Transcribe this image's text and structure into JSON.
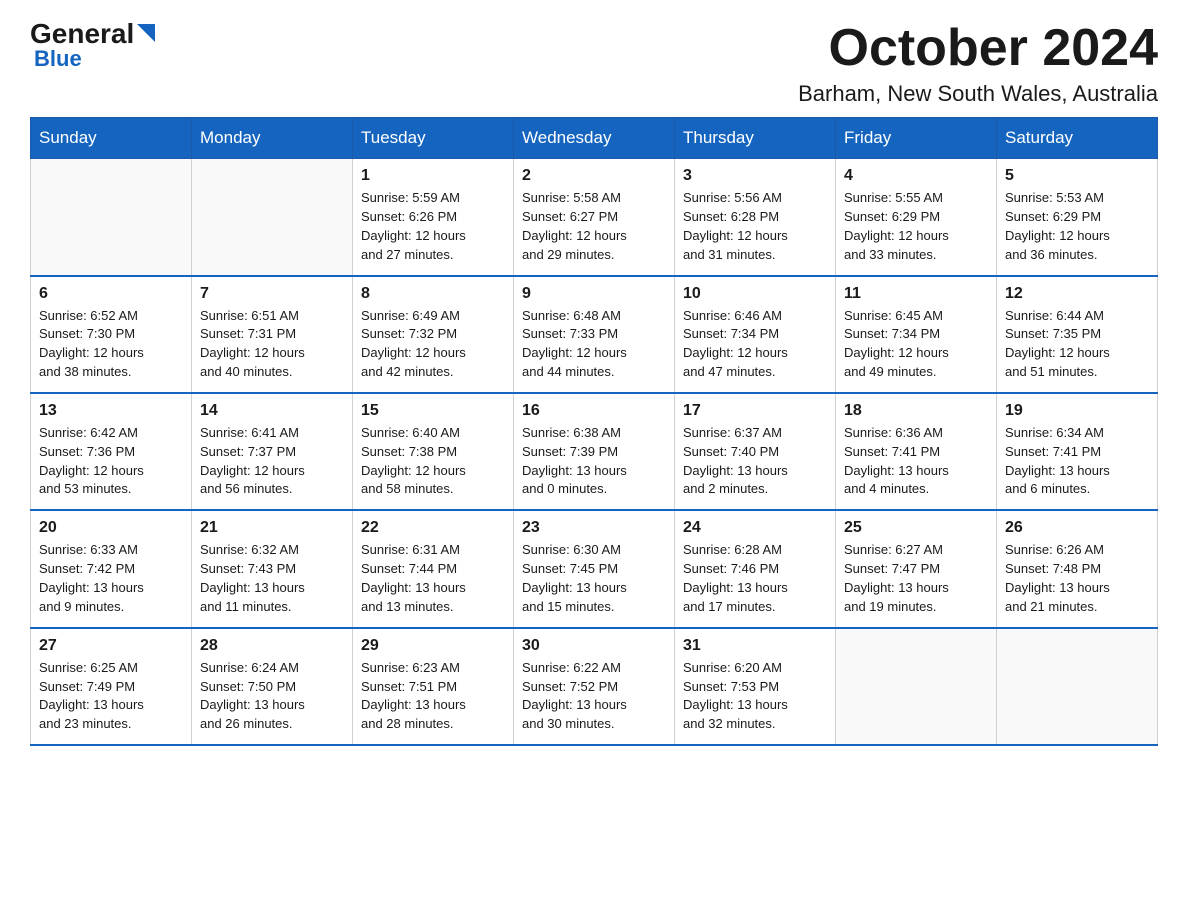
{
  "header": {
    "logo_general": "General",
    "logo_blue": "Blue",
    "month_title": "October 2024",
    "location": "Barham, New South Wales, Australia"
  },
  "weekdays": [
    "Sunday",
    "Monday",
    "Tuesday",
    "Wednesday",
    "Thursday",
    "Friday",
    "Saturday"
  ],
  "weeks": [
    [
      {
        "day": "",
        "info": ""
      },
      {
        "day": "",
        "info": ""
      },
      {
        "day": "1",
        "info": "Sunrise: 5:59 AM\nSunset: 6:26 PM\nDaylight: 12 hours\nand 27 minutes."
      },
      {
        "day": "2",
        "info": "Sunrise: 5:58 AM\nSunset: 6:27 PM\nDaylight: 12 hours\nand 29 minutes."
      },
      {
        "day": "3",
        "info": "Sunrise: 5:56 AM\nSunset: 6:28 PM\nDaylight: 12 hours\nand 31 minutes."
      },
      {
        "day": "4",
        "info": "Sunrise: 5:55 AM\nSunset: 6:29 PM\nDaylight: 12 hours\nand 33 minutes."
      },
      {
        "day": "5",
        "info": "Sunrise: 5:53 AM\nSunset: 6:29 PM\nDaylight: 12 hours\nand 36 minutes."
      }
    ],
    [
      {
        "day": "6",
        "info": "Sunrise: 6:52 AM\nSunset: 7:30 PM\nDaylight: 12 hours\nand 38 minutes."
      },
      {
        "day": "7",
        "info": "Sunrise: 6:51 AM\nSunset: 7:31 PM\nDaylight: 12 hours\nand 40 minutes."
      },
      {
        "day": "8",
        "info": "Sunrise: 6:49 AM\nSunset: 7:32 PM\nDaylight: 12 hours\nand 42 minutes."
      },
      {
        "day": "9",
        "info": "Sunrise: 6:48 AM\nSunset: 7:33 PM\nDaylight: 12 hours\nand 44 minutes."
      },
      {
        "day": "10",
        "info": "Sunrise: 6:46 AM\nSunset: 7:34 PM\nDaylight: 12 hours\nand 47 minutes."
      },
      {
        "day": "11",
        "info": "Sunrise: 6:45 AM\nSunset: 7:34 PM\nDaylight: 12 hours\nand 49 minutes."
      },
      {
        "day": "12",
        "info": "Sunrise: 6:44 AM\nSunset: 7:35 PM\nDaylight: 12 hours\nand 51 minutes."
      }
    ],
    [
      {
        "day": "13",
        "info": "Sunrise: 6:42 AM\nSunset: 7:36 PM\nDaylight: 12 hours\nand 53 minutes."
      },
      {
        "day": "14",
        "info": "Sunrise: 6:41 AM\nSunset: 7:37 PM\nDaylight: 12 hours\nand 56 minutes."
      },
      {
        "day": "15",
        "info": "Sunrise: 6:40 AM\nSunset: 7:38 PM\nDaylight: 12 hours\nand 58 minutes."
      },
      {
        "day": "16",
        "info": "Sunrise: 6:38 AM\nSunset: 7:39 PM\nDaylight: 13 hours\nand 0 minutes."
      },
      {
        "day": "17",
        "info": "Sunrise: 6:37 AM\nSunset: 7:40 PM\nDaylight: 13 hours\nand 2 minutes."
      },
      {
        "day": "18",
        "info": "Sunrise: 6:36 AM\nSunset: 7:41 PM\nDaylight: 13 hours\nand 4 minutes."
      },
      {
        "day": "19",
        "info": "Sunrise: 6:34 AM\nSunset: 7:41 PM\nDaylight: 13 hours\nand 6 minutes."
      }
    ],
    [
      {
        "day": "20",
        "info": "Sunrise: 6:33 AM\nSunset: 7:42 PM\nDaylight: 13 hours\nand 9 minutes."
      },
      {
        "day": "21",
        "info": "Sunrise: 6:32 AM\nSunset: 7:43 PM\nDaylight: 13 hours\nand 11 minutes."
      },
      {
        "day": "22",
        "info": "Sunrise: 6:31 AM\nSunset: 7:44 PM\nDaylight: 13 hours\nand 13 minutes."
      },
      {
        "day": "23",
        "info": "Sunrise: 6:30 AM\nSunset: 7:45 PM\nDaylight: 13 hours\nand 15 minutes."
      },
      {
        "day": "24",
        "info": "Sunrise: 6:28 AM\nSunset: 7:46 PM\nDaylight: 13 hours\nand 17 minutes."
      },
      {
        "day": "25",
        "info": "Sunrise: 6:27 AM\nSunset: 7:47 PM\nDaylight: 13 hours\nand 19 minutes."
      },
      {
        "day": "26",
        "info": "Sunrise: 6:26 AM\nSunset: 7:48 PM\nDaylight: 13 hours\nand 21 minutes."
      }
    ],
    [
      {
        "day": "27",
        "info": "Sunrise: 6:25 AM\nSunset: 7:49 PM\nDaylight: 13 hours\nand 23 minutes."
      },
      {
        "day": "28",
        "info": "Sunrise: 6:24 AM\nSunset: 7:50 PM\nDaylight: 13 hours\nand 26 minutes."
      },
      {
        "day": "29",
        "info": "Sunrise: 6:23 AM\nSunset: 7:51 PM\nDaylight: 13 hours\nand 28 minutes."
      },
      {
        "day": "30",
        "info": "Sunrise: 6:22 AM\nSunset: 7:52 PM\nDaylight: 13 hours\nand 30 minutes."
      },
      {
        "day": "31",
        "info": "Sunrise: 6:20 AM\nSunset: 7:53 PM\nDaylight: 13 hours\nand 32 minutes."
      },
      {
        "day": "",
        "info": ""
      },
      {
        "day": "",
        "info": ""
      }
    ]
  ]
}
